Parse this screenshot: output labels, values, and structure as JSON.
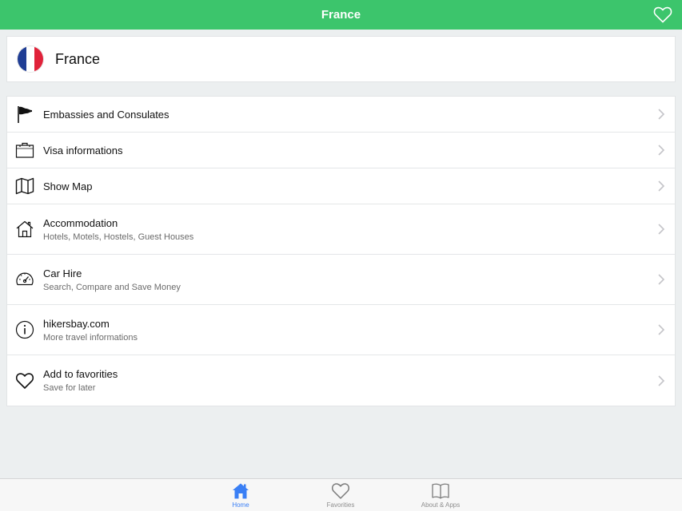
{
  "header": {
    "title": "France"
  },
  "country": {
    "name": "France",
    "flag_colors": [
      "#1f3d94",
      "#ffffff",
      "#e0223a"
    ]
  },
  "menu": [
    {
      "title": "Embassies and Consulates",
      "subtitle": "",
      "icon": "flag-icon"
    },
    {
      "title": "Visa informations",
      "subtitle": "",
      "icon": "briefcase-icon"
    },
    {
      "title": "Show Map",
      "subtitle": "",
      "icon": "map-icon"
    },
    {
      "title": "Accommodation",
      "subtitle": "Hotels, Motels, Hostels, Guest Houses",
      "icon": "house-icon"
    },
    {
      "title": "Car Hire",
      "subtitle": "Search, Compare and Save Money",
      "icon": "speedometer-icon"
    },
    {
      "title": "hikersbay.com",
      "subtitle": "More travel informations",
      "icon": "info-icon"
    },
    {
      "title": "Add to favorities",
      "subtitle": "Save for later",
      "icon": "heart-icon"
    }
  ],
  "tabs": [
    {
      "label": "Home",
      "icon": "home-icon",
      "active": true
    },
    {
      "label": "Favorities",
      "icon": "heart-icon",
      "active": false
    },
    {
      "label": "About & Apps",
      "icon": "book-icon",
      "active": false
    }
  ],
  "colors": {
    "accent": "#3cc56c",
    "active_tab": "#3a7ff5",
    "background": "#eceff0"
  }
}
